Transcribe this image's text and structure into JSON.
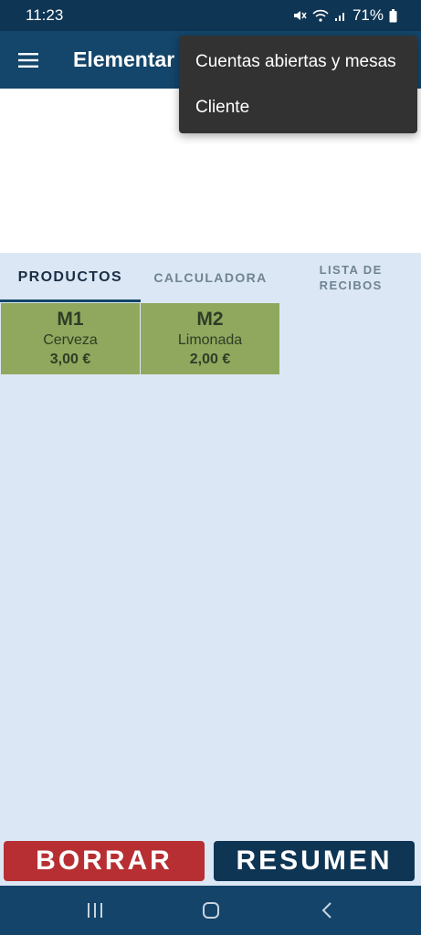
{
  "status_bar": {
    "time": "11:23",
    "battery": "71%",
    "icons": [
      "mute-icon",
      "wifi-icon",
      "signal-icon",
      "battery-icon"
    ]
  },
  "app_bar": {
    "title": "Elementar",
    "menu_icon": "hamburger-menu-icon"
  },
  "overflow_menu": {
    "items": [
      {
        "label": "Cuentas abiertas y mesas"
      },
      {
        "label": "Cliente"
      }
    ]
  },
  "tabs": [
    {
      "label": "PRODUCTOS",
      "active": true
    },
    {
      "label": "CALCULADORA",
      "active": false
    },
    {
      "label": "LISTA DE\nRECIBOS",
      "active": false
    }
  ],
  "products": [
    {
      "code": "M1",
      "name": "Cerveza",
      "price": "3,00 €"
    },
    {
      "code": "M2",
      "name": "Limonada",
      "price": "2,00 €"
    }
  ],
  "actions": {
    "clear_label": "BORRAR",
    "summary_label": "RESUMEN"
  },
  "nav_bar": {
    "icons": [
      "recent-apps-icon",
      "home-icon",
      "back-icon"
    ]
  },
  "colors": {
    "primary": "#14456a",
    "status_bar": "#0f3554",
    "background": "#dbe7f5",
    "product_tile": "#8fa85e",
    "danger": "#b72f32",
    "menu_bg": "#323232"
  }
}
